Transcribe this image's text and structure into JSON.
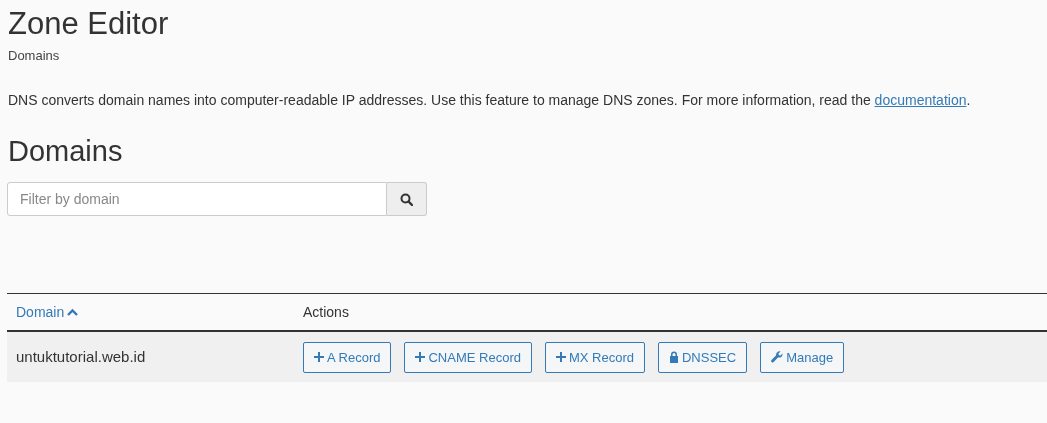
{
  "page": {
    "title": "Zone Editor",
    "breadcrumb": "Domains"
  },
  "description": {
    "text_before": "DNS converts domain names into computer-readable IP addresses. Use this feature to manage DNS zones. For more information, read the ",
    "link": "documentation",
    "text_after": "."
  },
  "section_heading": "Domains",
  "filter": {
    "placeholder": "Filter by domain"
  },
  "table": {
    "columns": [
      {
        "label": "Domain",
        "sorted": true
      },
      {
        "label": "Actions",
        "sorted": false
      }
    ],
    "rows": [
      {
        "domain": "untuktutorial.web.id",
        "actions": [
          {
            "label": "A Record",
            "kind": "add"
          },
          {
            "label": "CNAME Record",
            "kind": "add"
          },
          {
            "label": "MX Record",
            "kind": "add"
          },
          {
            "label": "DNSSEC",
            "kind": "secure"
          },
          {
            "label": "Manage",
            "kind": "manage"
          }
        ]
      }
    ]
  }
}
